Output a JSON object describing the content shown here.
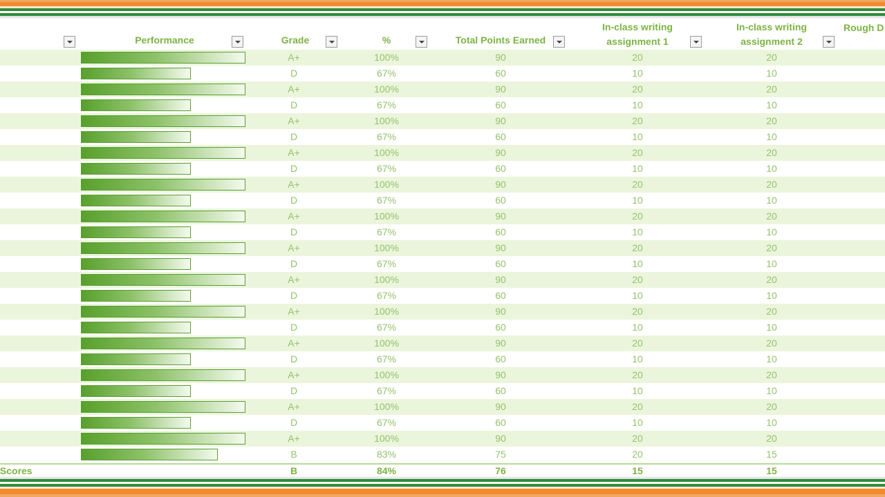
{
  "header": {
    "columns": [
      {
        "key": "first",
        "label": ""
      },
      {
        "key": "performance",
        "label": "Performance"
      },
      {
        "key": "grade",
        "label": "Grade"
      },
      {
        "key": "pct",
        "label": "%"
      },
      {
        "key": "total",
        "label": "Total Points Earned"
      },
      {
        "key": "wa1",
        "label": "In-class writing\nassignment 1"
      },
      {
        "key": "wa2",
        "label": "In-class writing\nassignment 2"
      },
      {
        "key": "rough",
        "label": "Rough D"
      }
    ]
  },
  "rows": [
    {
      "performance": 1.0,
      "grade": "A+",
      "pct": "100%",
      "total": "90",
      "wa1": "20",
      "wa2": "20"
    },
    {
      "performance": 0.67,
      "grade": "D",
      "pct": "67%",
      "total": "60",
      "wa1": "10",
      "wa2": "10"
    },
    {
      "performance": 1.0,
      "grade": "A+",
      "pct": "100%",
      "total": "90",
      "wa1": "20",
      "wa2": "20"
    },
    {
      "performance": 0.67,
      "grade": "D",
      "pct": "67%",
      "total": "60",
      "wa1": "10",
      "wa2": "10"
    },
    {
      "performance": 1.0,
      "grade": "A+",
      "pct": "100%",
      "total": "90",
      "wa1": "20",
      "wa2": "20"
    },
    {
      "performance": 0.67,
      "grade": "D",
      "pct": "67%",
      "total": "60",
      "wa1": "10",
      "wa2": "10"
    },
    {
      "performance": 1.0,
      "grade": "A+",
      "pct": "100%",
      "total": "90",
      "wa1": "20",
      "wa2": "20"
    },
    {
      "performance": 0.67,
      "grade": "D",
      "pct": "67%",
      "total": "60",
      "wa1": "10",
      "wa2": "10"
    },
    {
      "performance": 1.0,
      "grade": "A+",
      "pct": "100%",
      "total": "90",
      "wa1": "20",
      "wa2": "20"
    },
    {
      "performance": 0.67,
      "grade": "D",
      "pct": "67%",
      "total": "60",
      "wa1": "10",
      "wa2": "10"
    },
    {
      "performance": 1.0,
      "grade": "A+",
      "pct": "100%",
      "total": "90",
      "wa1": "20",
      "wa2": "20"
    },
    {
      "performance": 0.67,
      "grade": "D",
      "pct": "67%",
      "total": "60",
      "wa1": "10",
      "wa2": "10"
    },
    {
      "performance": 1.0,
      "grade": "A+",
      "pct": "100%",
      "total": "90",
      "wa1": "20",
      "wa2": "20"
    },
    {
      "performance": 0.67,
      "grade": "D",
      "pct": "67%",
      "total": "60",
      "wa1": "10",
      "wa2": "10"
    },
    {
      "performance": 1.0,
      "grade": "A+",
      "pct": "100%",
      "total": "90",
      "wa1": "20",
      "wa2": "20"
    },
    {
      "performance": 0.67,
      "grade": "D",
      "pct": "67%",
      "total": "60",
      "wa1": "10",
      "wa2": "10"
    },
    {
      "performance": 1.0,
      "grade": "A+",
      "pct": "100%",
      "total": "90",
      "wa1": "20",
      "wa2": "20"
    },
    {
      "performance": 0.67,
      "grade": "D",
      "pct": "67%",
      "total": "60",
      "wa1": "10",
      "wa2": "10"
    },
    {
      "performance": 1.0,
      "grade": "A+",
      "pct": "100%",
      "total": "90",
      "wa1": "20",
      "wa2": "20"
    },
    {
      "performance": 0.67,
      "grade": "D",
      "pct": "67%",
      "total": "60",
      "wa1": "10",
      "wa2": "10"
    },
    {
      "performance": 1.0,
      "grade": "A+",
      "pct": "100%",
      "total": "90",
      "wa1": "20",
      "wa2": "20"
    },
    {
      "performance": 0.67,
      "grade": "D",
      "pct": "67%",
      "total": "60",
      "wa1": "10",
      "wa2": "10"
    },
    {
      "performance": 1.0,
      "grade": "A+",
      "pct": "100%",
      "total": "90",
      "wa1": "20",
      "wa2": "20"
    },
    {
      "performance": 0.67,
      "grade": "D",
      "pct": "67%",
      "total": "60",
      "wa1": "10",
      "wa2": "10"
    },
    {
      "performance": 1.0,
      "grade": "A+",
      "pct": "100%",
      "total": "90",
      "wa1": "20",
      "wa2": "20"
    },
    {
      "performance": 0.83,
      "grade": "B",
      "pct": "83%",
      "total": "75",
      "wa1": "20",
      "wa2": "15"
    }
  ],
  "totals": {
    "label": "/Scores",
    "grade": "B",
    "pct": "84%",
    "total": "76",
    "wa1": "15",
    "wa2": "15"
  },
  "colors": {
    "accent_green": "#7cb342",
    "bar_green": "#58a02c",
    "band_green": "#ebf5dc",
    "border_orange": "#f28a30"
  }
}
